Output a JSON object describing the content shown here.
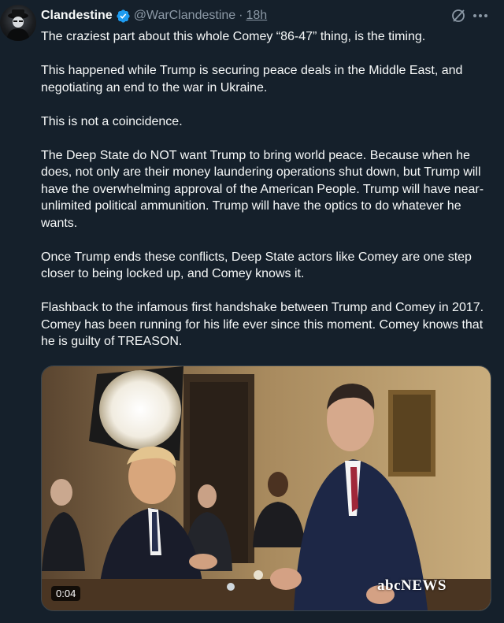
{
  "author": {
    "display_name": "Clandestine",
    "handle": "@WarClandestine",
    "separator": "·",
    "timestamp": "18h"
  },
  "icons": {
    "avatar": "clandestine-avatar",
    "verified": "verified-badge-icon",
    "grok": "grok-icon",
    "more": "more-options-icon"
  },
  "tweet": {
    "paragraphs": [
      "The craziest part about this whole Comey “86-47” thing, is the timing.",
      "This happened while Trump is securing peace deals in the Middle East, and negotiating an end to the war in Ukraine.",
      "This is not a coincidence.",
      "The Deep State do NOT want Trump to bring world peace. Because when he does, not only are their money laundering operations shut down, but Trump will have the overwhelming approval of the American People. Trump will have near-unlimited political ammunition. Trump will have the optics to do whatever he wants.",
      "Once Trump ends these conflicts, Deep State actors like Comey are one step closer to being locked up, and Comey knows it.",
      "Flashback to the infamous first handshake between Trump and Comey in 2017. Comey has been running for his life ever since this moment. Comey knows that he is guilty of TREASON."
    ]
  },
  "media": {
    "duration": "0:04",
    "network_logo": "abcNEWS"
  },
  "colors": {
    "background": "#15202b",
    "text": "#f7f9f9",
    "secondary_text": "#8b98a5",
    "verified_blue": "#1d9bf0"
  }
}
